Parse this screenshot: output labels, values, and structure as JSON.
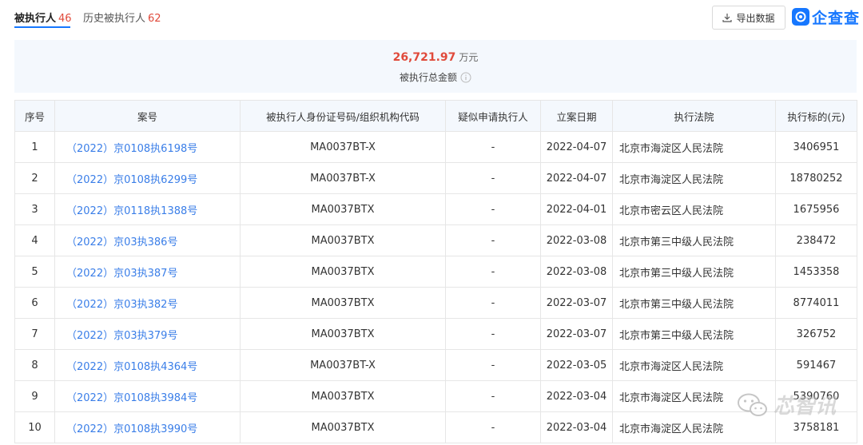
{
  "tabs": [
    {
      "label": "被执行人",
      "count": "46"
    },
    {
      "label": "历史被执行人",
      "count": "62"
    }
  ],
  "toolbar": {
    "export_label": "导出数据"
  },
  "logo": {
    "text": "企查查"
  },
  "summary": {
    "amount": "26,721.97",
    "unit": "万元",
    "label": "被执行总金额"
  },
  "table": {
    "headers": [
      "序号",
      "案号",
      "被执行人身份证号码/组织机构代码",
      "疑似申请执行人",
      "立案日期",
      "执行法院",
      "执行标的(元)"
    ],
    "rows": [
      {
        "no": "1",
        "case": "（2022）京0108执6198号",
        "code": "MA0037BT-X",
        "applicant": "-",
        "date": "2022-04-07",
        "court": "北京市海淀区人民法院",
        "amount": "3406951"
      },
      {
        "no": "2",
        "case": "（2022）京0108执6299号",
        "code": "MA0037BT-X",
        "applicant": "-",
        "date": "2022-04-07",
        "court": "北京市海淀区人民法院",
        "amount": "18780252"
      },
      {
        "no": "3",
        "case": "（2022）京0118执1388号",
        "code": "MA0037BTX",
        "applicant": "-",
        "date": "2022-04-01",
        "court": "北京市密云区人民法院",
        "amount": "1675956"
      },
      {
        "no": "4",
        "case": "（2022）京03执386号",
        "code": "MA0037BTX",
        "applicant": "-",
        "date": "2022-03-08",
        "court": "北京市第三中级人民法院",
        "amount": "238472"
      },
      {
        "no": "5",
        "case": "（2022）京03执387号",
        "code": "MA0037BTX",
        "applicant": "-",
        "date": "2022-03-08",
        "court": "北京市第三中级人民法院",
        "amount": "1453358"
      },
      {
        "no": "6",
        "case": "（2022）京03执382号",
        "code": "MA0037BTX",
        "applicant": "-",
        "date": "2022-03-07",
        "court": "北京市第三中级人民法院",
        "amount": "8774011"
      },
      {
        "no": "7",
        "case": "（2022）京03执379号",
        "code": "MA0037BTX",
        "applicant": "-",
        "date": "2022-03-07",
        "court": "北京市第三中级人民法院",
        "amount": "326752"
      },
      {
        "no": "8",
        "case": "（2022）京0108执4364号",
        "code": "MA0037BT-X",
        "applicant": "-",
        "date": "2022-03-05",
        "court": "北京市海淀区人民法院",
        "amount": "591467"
      },
      {
        "no": "9",
        "case": "（2022）京0108执3984号",
        "code": "MA0037BTX",
        "applicant": "-",
        "date": "2022-03-04",
        "court": "北京市海淀区人民法院",
        "amount": "5390760"
      },
      {
        "no": "10",
        "case": "（2022）京0108执3990号",
        "code": "MA0037BTX",
        "applicant": "-",
        "date": "2022-03-04",
        "court": "北京市海淀区人民法院",
        "amount": "3758181"
      }
    ]
  },
  "watermark": {
    "text": "芯智讯"
  },
  "icons": {
    "export": "download-icon",
    "info": "info-icon",
    "logo": "logo-icon",
    "watermark": "wechat-icon"
  },
  "colors": {
    "accent": "#1677ff",
    "count": "#e04a3b",
    "link": "#3a7ee8",
    "header_bg": "#f4f8fd"
  }
}
